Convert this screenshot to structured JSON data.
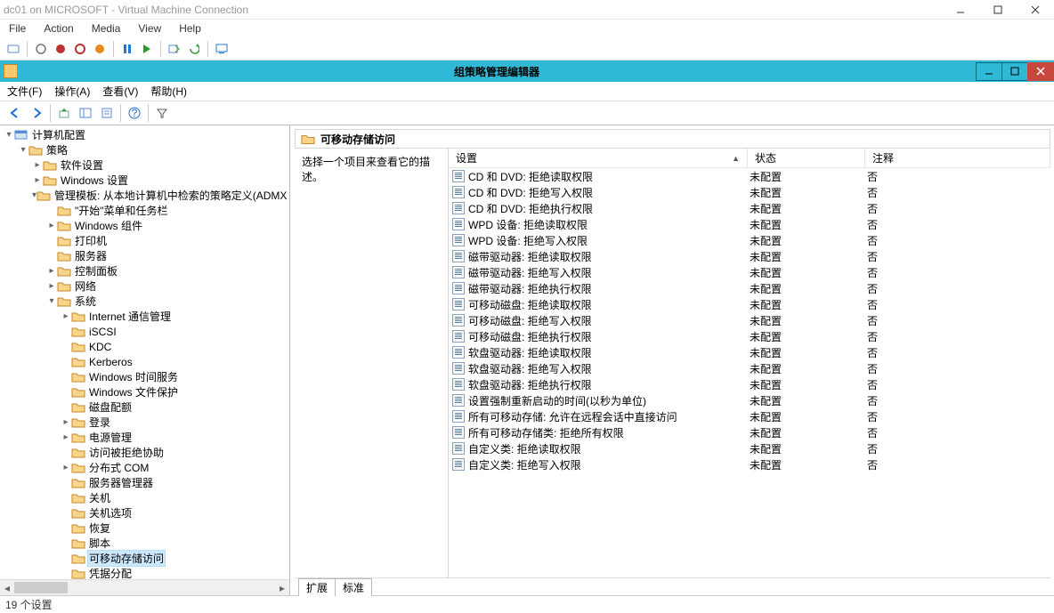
{
  "vm": {
    "title": "dc01 on MICROSOFT - Virtual Machine Connection",
    "menus": [
      "File",
      "Action",
      "Media",
      "View",
      "Help"
    ]
  },
  "gp": {
    "title": "组策略管理编辑器",
    "menus": [
      "文件(F)",
      "操作(A)",
      "查看(V)",
      "帮助(H)"
    ],
    "right_header": "可移动存储访问",
    "desc": "选择一个项目来查看它的描述。",
    "cols": {
      "c1": "设置",
      "c2": "状态",
      "c3": "注释"
    },
    "tabs": {
      "ext": "扩展",
      "std": "标准"
    },
    "status": "19 个设置"
  },
  "tree": [
    {
      "d": 0,
      "tw": "▾",
      "icon": "root",
      "label": "计算机配置"
    },
    {
      "d": 1,
      "tw": "▾",
      "icon": "folder",
      "label": "策略"
    },
    {
      "d": 2,
      "tw": "▸",
      "icon": "folder",
      "label": "软件设置"
    },
    {
      "d": 2,
      "tw": "▸",
      "icon": "folder",
      "label": "Windows 设置"
    },
    {
      "d": 2,
      "tw": "▾",
      "icon": "folder",
      "label": "管理模板: 从本地计算机中检索的策略定义(ADMX"
    },
    {
      "d": 3,
      "tw": "",
      "icon": "folder",
      "label": "\"开始\"菜单和任务栏"
    },
    {
      "d": 3,
      "tw": "▸",
      "icon": "folder",
      "label": "Windows 组件"
    },
    {
      "d": 3,
      "tw": "",
      "icon": "folder",
      "label": "打印机"
    },
    {
      "d": 3,
      "tw": "",
      "icon": "folder",
      "label": "服务器"
    },
    {
      "d": 3,
      "tw": "▸",
      "icon": "folder",
      "label": "控制面板"
    },
    {
      "d": 3,
      "tw": "▸",
      "icon": "folder",
      "label": "网络"
    },
    {
      "d": 3,
      "tw": "▾",
      "icon": "folder",
      "label": "系统"
    },
    {
      "d": 4,
      "tw": "▸",
      "icon": "folder",
      "label": "Internet 通信管理"
    },
    {
      "d": 4,
      "tw": "",
      "icon": "folder",
      "label": "iSCSI"
    },
    {
      "d": 4,
      "tw": "",
      "icon": "folder",
      "label": "KDC"
    },
    {
      "d": 4,
      "tw": "",
      "icon": "folder",
      "label": "Kerberos"
    },
    {
      "d": 4,
      "tw": "",
      "icon": "folder",
      "label": "Windows 时间服务"
    },
    {
      "d": 4,
      "tw": "",
      "icon": "folder",
      "label": "Windows 文件保护"
    },
    {
      "d": 4,
      "tw": "",
      "icon": "folder",
      "label": "磁盘配额"
    },
    {
      "d": 4,
      "tw": "▸",
      "icon": "folder",
      "label": "登录"
    },
    {
      "d": 4,
      "tw": "▸",
      "icon": "folder",
      "label": "电源管理"
    },
    {
      "d": 4,
      "tw": "",
      "icon": "folder",
      "label": "访问被拒绝协助"
    },
    {
      "d": 4,
      "tw": "▸",
      "icon": "folder",
      "label": "分布式 COM"
    },
    {
      "d": 4,
      "tw": "",
      "icon": "folder",
      "label": "服务器管理器"
    },
    {
      "d": 4,
      "tw": "",
      "icon": "folder",
      "label": "关机"
    },
    {
      "d": 4,
      "tw": "",
      "icon": "folder",
      "label": "关机选项"
    },
    {
      "d": 4,
      "tw": "",
      "icon": "folder",
      "label": "恢复"
    },
    {
      "d": 4,
      "tw": "",
      "icon": "folder",
      "label": "脚本"
    },
    {
      "d": 4,
      "tw": "",
      "icon": "folder",
      "label": "可移动存储访问",
      "sel": true
    },
    {
      "d": 4,
      "tw": "",
      "icon": "folder",
      "label": "凭据分配"
    }
  ],
  "rows": [
    {
      "t": "CD 和 DVD: 拒绝读取权限",
      "s": "未配置",
      "n": "否"
    },
    {
      "t": "CD 和 DVD: 拒绝写入权限",
      "s": "未配置",
      "n": "否"
    },
    {
      "t": "CD 和 DVD: 拒绝执行权限",
      "s": "未配置",
      "n": "否"
    },
    {
      "t": "WPD 设备: 拒绝读取权限",
      "s": "未配置",
      "n": "否"
    },
    {
      "t": "WPD 设备: 拒绝写入权限",
      "s": "未配置",
      "n": "否"
    },
    {
      "t": "磁带驱动器: 拒绝读取权限",
      "s": "未配置",
      "n": "否"
    },
    {
      "t": "磁带驱动器: 拒绝写入权限",
      "s": "未配置",
      "n": "否"
    },
    {
      "t": "磁带驱动器: 拒绝执行权限",
      "s": "未配置",
      "n": "否"
    },
    {
      "t": "可移动磁盘: 拒绝读取权限",
      "s": "未配置",
      "n": "否"
    },
    {
      "t": "可移动磁盘: 拒绝写入权限",
      "s": "未配置",
      "n": "否"
    },
    {
      "t": "可移动磁盘: 拒绝执行权限",
      "s": "未配置",
      "n": "否"
    },
    {
      "t": "软盘驱动器: 拒绝读取权限",
      "s": "未配置",
      "n": "否"
    },
    {
      "t": "软盘驱动器: 拒绝写入权限",
      "s": "未配置",
      "n": "否"
    },
    {
      "t": "软盘驱动器: 拒绝执行权限",
      "s": "未配置",
      "n": "否"
    },
    {
      "t": "设置强制重新启动的时间(以秒为单位)",
      "s": "未配置",
      "n": "否"
    },
    {
      "t": "所有可移动存储: 允许在远程会话中直接访问",
      "s": "未配置",
      "n": "否"
    },
    {
      "t": "所有可移动存储类: 拒绝所有权限",
      "s": "未配置",
      "n": "否"
    },
    {
      "t": "自定义类: 拒绝读取权限",
      "s": "未配置",
      "n": "否"
    },
    {
      "t": "自定义类: 拒绝写入权限",
      "s": "未配置",
      "n": "否"
    }
  ]
}
